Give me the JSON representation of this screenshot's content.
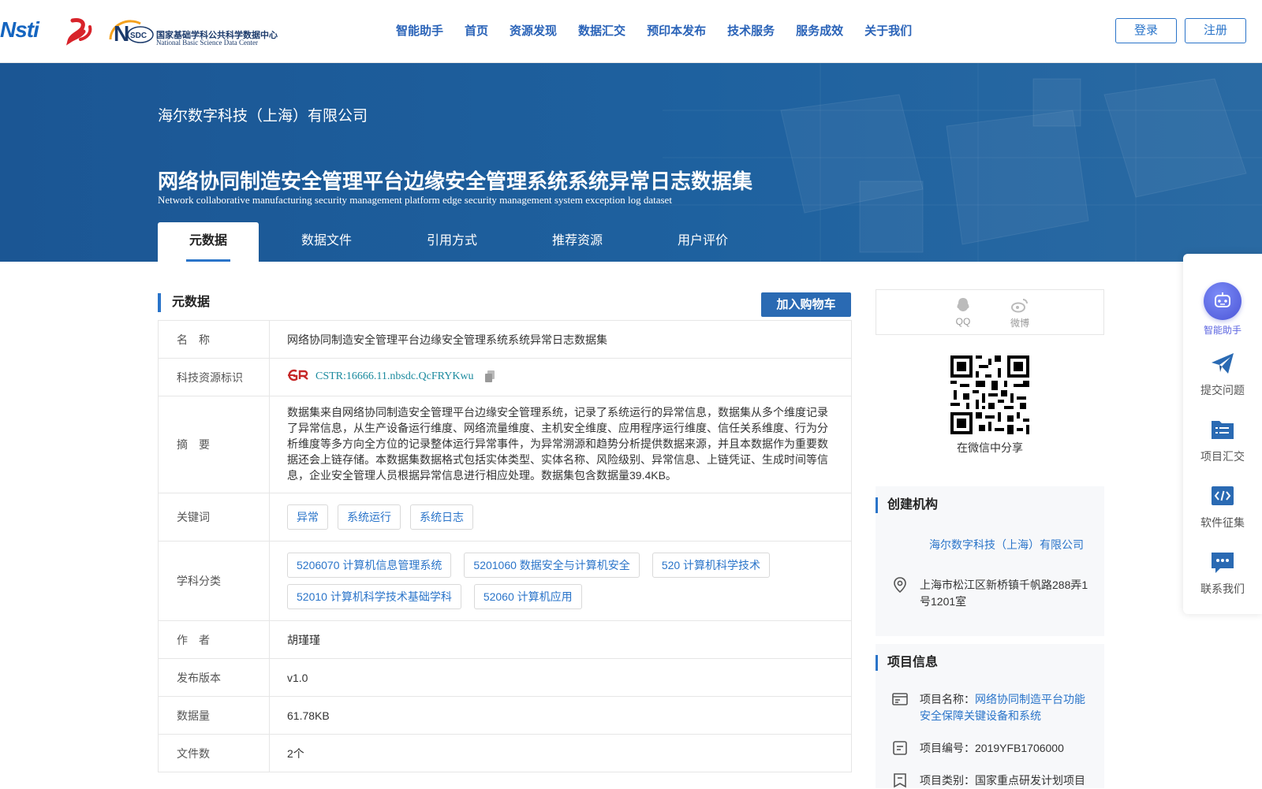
{
  "header": {
    "logo_nsti_text": "Nsti",
    "logo_nsdc_cn": "国家基础学科公共科学数据中心",
    "logo_nsdc_en": "National Basic Science Data Center",
    "logo_nsdc_mark": "NSDC",
    "nav": [
      "智能助手",
      "首页",
      "资源发现",
      "数据汇交",
      "预印本发布",
      "技术服务",
      "服务成效",
      "关于我们"
    ],
    "login": "登录",
    "register": "注册"
  },
  "banner": {
    "org": "海尔数字科技（上海）有限公司",
    "title": "网络协同制造安全管理平台边缘安全管理系统系统异常日志数据集",
    "title_en": "Network collaborative manufacturing security management platform edge security management system exception log dataset",
    "tabs": [
      "元数据",
      "数据文件",
      "引用方式",
      "推荐资源",
      "用户评价"
    ]
  },
  "metadata": {
    "section_title": "元数据",
    "cart_button": "加入购物车",
    "rows": {
      "name": {
        "label": "名　称",
        "value": "网络协同制造安全管理平台边缘安全管理系统系统异常日志数据集"
      },
      "cstr": {
        "label": "科技资源标识",
        "value": "CSTR:16666.11.nbsdc.QcFRYKwu",
        "logo": "CSTR"
      },
      "abstract": {
        "label": "摘　要",
        "value": "数据集来自网络协同制造安全管理平台边缘安全管理系统，记录了系统运行的异常信息，数据集从多个维度记录了异常信息，从生产设备运行维度、网络流量维度、主机安全维度、应用程序运行维度、信任关系维度、行为分析维度等多方向全方位的记录整体运行异常事件，为异常溯源和趋势分析提供数据来源，并且本数据作为重要数据还会上链存储。本数据集数据格式包括实体类型、实体名称、风险级别、异常信息、上链凭证、生成时间等信息，企业安全管理人员根据异常信息进行相应处理。数据集包含数据量39.4KB。"
      },
      "keywords": {
        "label": "关键词",
        "tags": [
          "异常",
          "系统运行",
          "系统日志"
        ]
      },
      "subjects": {
        "label": "学科分类",
        "tags": [
          "5206070 计算机信息管理系统",
          "5201060 数据安全与计算机安全",
          "520 计算机科学技术",
          "52010 计算机科学技术基础学科",
          "52060 计算机应用"
        ]
      },
      "author": {
        "label": "作　者",
        "value": "胡瑾瑾"
      },
      "version": {
        "label": "发布版本",
        "value": "v1.0"
      },
      "size": {
        "label": "数据量",
        "value": "61.78KB"
      },
      "files": {
        "label": "文件数",
        "value": "2个"
      }
    }
  },
  "sidebar": {
    "share": {
      "qq": "QQ",
      "weibo": "微博",
      "wechat_caption": "在微信中分享"
    },
    "creator": {
      "title": "创建机构",
      "org": "海尔数字科技（上海）有限公司",
      "address": "上海市松江区新桥镇千帆路288弄1号1201室"
    },
    "project": {
      "title": "项目信息",
      "name_label": "项目名称：",
      "name_value": "网络协同制造平台功能安全保障关键设备和系统",
      "code_label": "项目编号：",
      "code_value": "2019YFB1706000",
      "type_label": "项目类别：",
      "type_value": "国家重点研发计划项目"
    }
  },
  "float_bar": {
    "items": [
      "智能助手",
      "提交问题",
      "项目汇交",
      "软件征集",
      "联系我们"
    ]
  },
  "colors": {
    "primary": "#2a74c9",
    "banner": "#1e5d9c",
    "cart": "#2a6ab3"
  }
}
